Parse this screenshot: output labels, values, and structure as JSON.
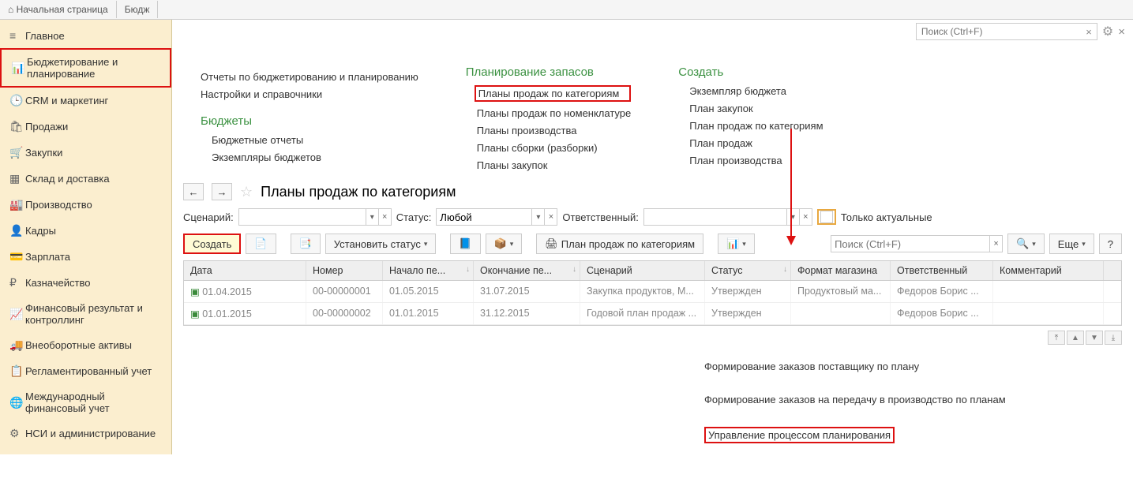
{
  "tabs": [
    "Начальная страница",
    "Бюдж"
  ],
  "sidebar": [
    {
      "icon": "≡",
      "label": "Главное"
    },
    {
      "icon": "📊",
      "label": "Бюджетирование и планирование",
      "hl": true
    },
    {
      "icon": "🕒",
      "label": "CRM и маркетинг"
    },
    {
      "icon": "🛍",
      "label": "Продажи"
    },
    {
      "icon": "🛒",
      "label": "Закупки"
    },
    {
      "icon": "▦",
      "label": "Склад и доставка"
    },
    {
      "icon": "🏭",
      "label": "Производство"
    },
    {
      "icon": "👤",
      "label": "Кадры"
    },
    {
      "icon": "💳",
      "label": "Зарплата"
    },
    {
      "icon": "₽",
      "label": "Казначейство"
    },
    {
      "icon": "📈",
      "label": "Финансовый результат и контроллинг"
    },
    {
      "icon": "🚚",
      "label": "Внеоборотные активы"
    },
    {
      "icon": "📋",
      "label": "Регламентированный учет"
    },
    {
      "icon": "🌐",
      "label": "Международный финансовый учет"
    },
    {
      "icon": "⚙",
      "label": "НСИ и администрирование"
    }
  ],
  "search_placeholder": "Поиск (Ctrl+F)",
  "categories": {
    "col1": {
      "links_top": [
        "Отчеты по бюджетированию и планированию",
        "Настройки и справочники"
      ],
      "heading": "Бюджеты",
      "links": [
        "Бюджетные отчеты",
        "Экземпляры бюджетов"
      ]
    },
    "col2": {
      "heading": "Планирование запасов",
      "links": [
        {
          "t": "Планы продаж по категориям",
          "hl": true
        },
        {
          "t": "Планы продаж по номенклатуре"
        },
        {
          "t": "Планы производства"
        },
        {
          "t": "Планы сборки (разборки)"
        },
        {
          "t": "Планы закупок"
        }
      ]
    },
    "col3": {
      "heading": "Создать",
      "links": [
        "Экземпляр бюджета",
        "План закупок",
        "План продаж по категориям",
        "План продаж",
        "План производства"
      ]
    }
  },
  "section_title": "Планы продаж по категориям",
  "filters": {
    "scenario_label": "Сценарий:",
    "status_label": "Статус:",
    "status_value": "Любой",
    "responsible_label": "Ответственный:",
    "actual_label": "Только актуальные"
  },
  "toolbar": {
    "create": "Создать",
    "set_status": "Установить статус",
    "plan_btn": "План продаж по категориям",
    "search_placeholder": "Поиск (Ctrl+F)",
    "more": "Еще"
  },
  "columns": [
    "Дата",
    "Номер",
    "Начало пе...",
    "Окончание пе...",
    "Сценарий",
    "Статус",
    "Формат магазина",
    "Ответственный",
    "Комментарий"
  ],
  "rows": [
    {
      "date": "01.04.2015",
      "num": "00-00000001",
      "start": "01.05.2015",
      "end": "31.07.2015",
      "scen": "Закупка продуктов, М...",
      "status": "Утвержден",
      "format": "Продуктовый ма...",
      "resp": "Федоров Борис ...",
      "comm": ""
    },
    {
      "date": "01.01.2015",
      "num": "00-00000002",
      "start": "01.01.2015",
      "end": "31.12.2015",
      "scen": "Годовой план продаж ...",
      "status": "Утвержден",
      "format": "",
      "resp": "Федоров Борис ...",
      "comm": ""
    }
  ],
  "footer_links": [
    {
      "t": "Формирование заказов поставщику по плану"
    },
    {
      "t": "Формирование заказов на передачу в производство по планам"
    },
    {
      "t": "Управление процессом планирования",
      "hl": true
    }
  ]
}
